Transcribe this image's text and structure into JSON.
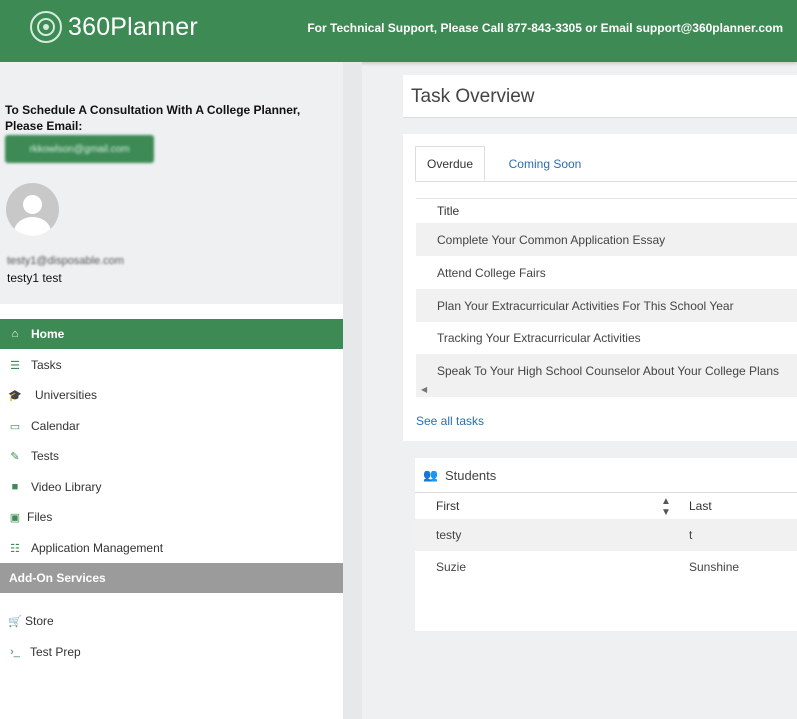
{
  "header": {
    "logo_text": "360Planner",
    "support_text": "For Technical Support, Please Call 877-843-3305 or Email support@360planner.com",
    "brand_color": "#3d8a55"
  },
  "sidebar": {
    "schedule_text": "To Schedule A Consultation With A College Planner, Please Email:",
    "planner_email": "rkkowlson@gmail.com",
    "user_email": "testy1@disposable.com",
    "user_name": "testy1 test",
    "nav": [
      {
        "label": "Home",
        "icon": "home-icon",
        "glyph": "⌂",
        "active": true
      },
      {
        "label": "Tasks",
        "icon": "tasks-icon",
        "glyph": "☰",
        "active": false
      },
      {
        "label": "Universities",
        "icon": "graduation-cap-icon",
        "glyph": "🎓",
        "active": false
      },
      {
        "label": "Calendar",
        "icon": "calendar-icon",
        "glyph": "▭",
        "active": false
      },
      {
        "label": "Tests",
        "icon": "edit-icon",
        "glyph": "✎",
        "active": false
      },
      {
        "label": "Video Library",
        "icon": "video-camera-icon",
        "glyph": "■",
        "active": false
      },
      {
        "label": "Files",
        "icon": "save-icon",
        "glyph": "▣",
        "active": false
      },
      {
        "label": "Application Management",
        "icon": "list-icon",
        "glyph": "☷",
        "active": false
      }
    ],
    "section_label": "Add-On Services",
    "addons": [
      {
        "label": "Store",
        "icon": "cart-icon",
        "glyph": "🛒"
      },
      {
        "label": "Test Prep",
        "icon": "terminal-icon",
        "glyph": "›_"
      }
    ]
  },
  "task_overview": {
    "title": "Task Overview",
    "tabs": [
      "Overdue",
      "Coming Soon"
    ],
    "column_header": "Title",
    "tasks": [
      "Complete Your Common Application Essay",
      "Attend College Fairs",
      "Plan Your Extracurricular Activities For This School Year",
      "Tracking Your Extracurricular Activities",
      "Speak To Your High School Counselor About Your College Plans"
    ],
    "see_all": "See all tasks"
  },
  "students": {
    "title": "Students",
    "columns": [
      "First",
      "Last"
    ],
    "rows": [
      {
        "first": "testy",
        "last": "t"
      },
      {
        "first": "Suzie",
        "last": "Sunshine"
      }
    ]
  }
}
